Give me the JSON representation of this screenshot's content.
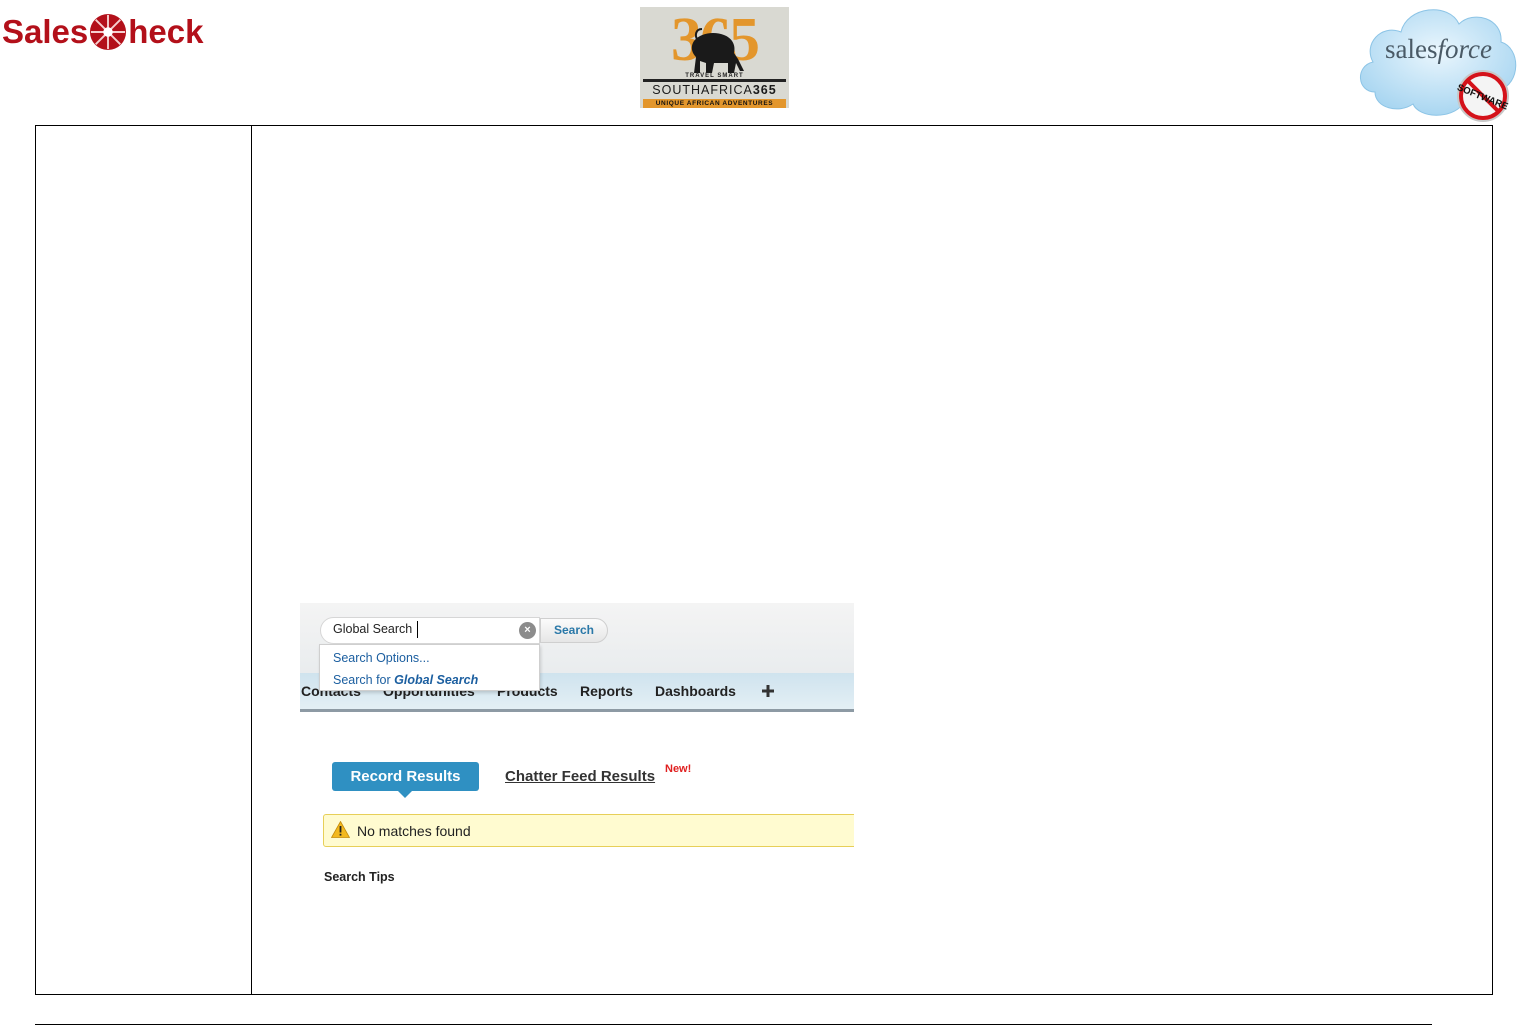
{
  "logos": {
    "salescheck_left": "Sales",
    "salescheck_right": "heck",
    "sa365_numbers": "365",
    "sa365_tagline_top": "TRAVEL SMART",
    "sa365_name_left": "SOUTHAFRICA",
    "sa365_name_right": "365",
    "sa365_tagline_bottom": "UNIQUE AFRICAN ADVENTURES",
    "salesforce_left": "sales",
    "salesforce_right": "force",
    "no_software_badge": "SOFTWARE"
  },
  "screenshot": {
    "search_value": "Global Search",
    "search_button": "Search",
    "dropdown": {
      "options_label": "Search Options...",
      "search_for_prefix": "Search for",
      "search_for_term": "Global Search"
    },
    "nav": {
      "items": [
        "Contacts",
        "Opportunities",
        "Products",
        "Reports",
        "Dashboards"
      ],
      "add_icon": "plus-icon"
    },
    "tabs": {
      "record_results": "Record Results",
      "chatter_feed_results": "Chatter Feed Results",
      "new_badge": "New!"
    },
    "alert": {
      "icon": "warning-icon",
      "message": "No matches found"
    },
    "search_tips": "Search Tips"
  },
  "colors": {
    "salescheck_red": "#b3101a",
    "sa365_orange": "#e3962c",
    "record_tab_blue": "#2f90c2",
    "link_blue": "#1c5fa0",
    "alert_bg": "#fffbd0",
    "new_badge_red": "#e02020"
  }
}
